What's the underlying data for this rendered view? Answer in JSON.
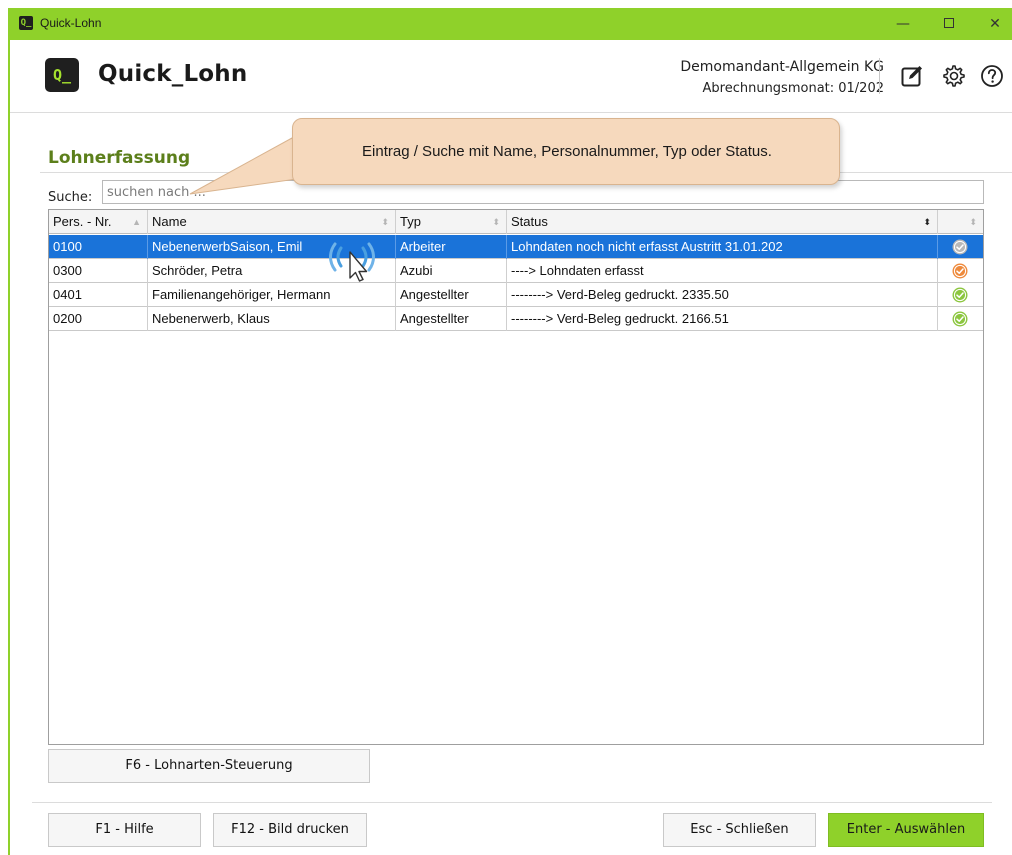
{
  "window": {
    "title": "Quick-Lohn",
    "icon": "Q_",
    "controls": {
      "minimize": "—",
      "maximize": "□",
      "close": "✕"
    }
  },
  "header": {
    "logo_text": "Q_",
    "app_name": "Quick_Lohn",
    "company": "Demomandant-Allgemein KG",
    "billing_month": "Abrechnungsmonat: 01/202",
    "icons": [
      "edit-icon",
      "gear-icon",
      "help-icon"
    ]
  },
  "page": {
    "title": "Lohnerfassung"
  },
  "search": {
    "label": "Suche:",
    "placeholder": "suchen nach ..."
  },
  "tooltip": {
    "text": "Eintrag / Suche mit Name, Personalnummer, Typ oder Status."
  },
  "table": {
    "columns": [
      "Pers. - Nr.",
      "Name",
      "Typ",
      "Status",
      ""
    ],
    "rows": [
      {
        "nr": "0100",
        "name": "NebenerwerbSaison, Emil",
        "typ": "Arbeiter",
        "status": "Lohndaten noch nicht erfasst  Austritt 31.01.202",
        "indicator": "grey",
        "selected": true
      },
      {
        "nr": "0300",
        "name": "Schröder, Petra",
        "typ": "Azubi",
        "status": "----> Lohndaten erfasst",
        "indicator": "orange",
        "selected": false
      },
      {
        "nr": "0401",
        "name": "Familienangehöriger, Hermann",
        "typ": "Angestellter",
        "status": "--------> Verd-Beleg gedruckt.   2335.50",
        "indicator": "green",
        "selected": false
      },
      {
        "nr": "0200",
        "name": "Nebenerwerb, Klaus",
        "typ": "Angestellter",
        "status": "--------> Verd-Beleg gedruckt.   2166.51",
        "indicator": "green",
        "selected": false
      }
    ]
  },
  "buttons": {
    "f6": "F6 - Lohnarten-Steuerung",
    "f1": "F1 - Hilfe",
    "f12": "F12 - Bild drucken",
    "esc": "Esc - Schließen",
    "enter": "Enter - Auswählen"
  },
  "colors": {
    "accent": "#8fd12a",
    "section_title": "#5c7f1b",
    "selection": "#1a73d9",
    "tooltip_bg": "#f6d9bd",
    "indicator_grey": "#b8b8b8",
    "indicator_orange": "#ee8a3c",
    "indicator_green": "#8cc63f"
  }
}
